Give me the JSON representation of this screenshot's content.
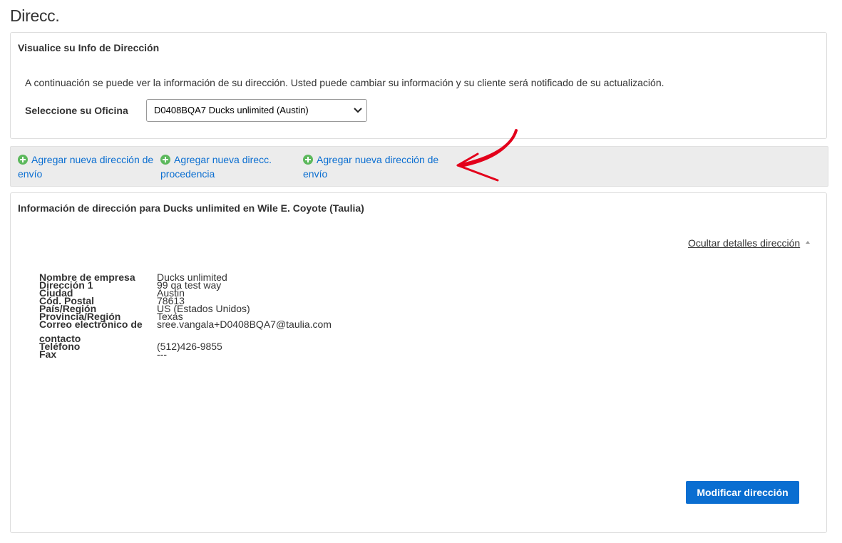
{
  "page": {
    "title": "Direcc."
  },
  "view_panel": {
    "title": "Visualice su Info de Dirección",
    "intro": "A continuación se puede ver la información de su dirección. Usted puede cambiar su información y su cliente será notificado de su actualización.",
    "office_label": "Seleccione su Oficina",
    "office_selected": "D0408BQA7 Ducks unlimited (Austin)"
  },
  "actions": {
    "add_shipping": "Agregar nueva dirección de envío",
    "add_origin": "Agregar nueva direcc. procedencia",
    "add_shipping_2": "Agregar nueva dirección de envío"
  },
  "info_panel": {
    "title": "Información de dirección para Ducks unlimited en Wile E. Coyote (Taulia)",
    "toggle_label": "Ocultar detalles dirección",
    "fields": {
      "company": {
        "label": "Nombre de empresa",
        "value": "Ducks unlimited"
      },
      "address1": {
        "label": "Dirección 1",
        "value": "99 qa test way"
      },
      "city": {
        "label": "Ciudad",
        "value": "Austin"
      },
      "postal": {
        "label": "Cód. Postal",
        "value": "78613"
      },
      "country": {
        "label": "País/Región",
        "value": "US (Estados Unidos)"
      },
      "province": {
        "label": "Provincia/Región",
        "value": "Texas"
      },
      "email": {
        "label": "Correo electrónico de contacto",
        "value": "sree.vangala+D0408BQA7@taulia.com"
      },
      "phone": {
        "label": "Teléfono",
        "value": "(512)426-9855"
      },
      "fax": {
        "label": "Fax",
        "value": "---"
      }
    },
    "modify_label": "Modificar dirección"
  },
  "icons": {
    "plus": "plus-circle-icon",
    "chevron": "chevron-down-icon",
    "caret": "caret-up-icon",
    "annotation": "red-arrow-annotation"
  },
  "colors": {
    "link": "#0a6ed1",
    "primary_button": "#0a6ed1",
    "plus_icon": "#5cb85c",
    "action_bar": "#ececec",
    "annotation": "#e3001b"
  }
}
